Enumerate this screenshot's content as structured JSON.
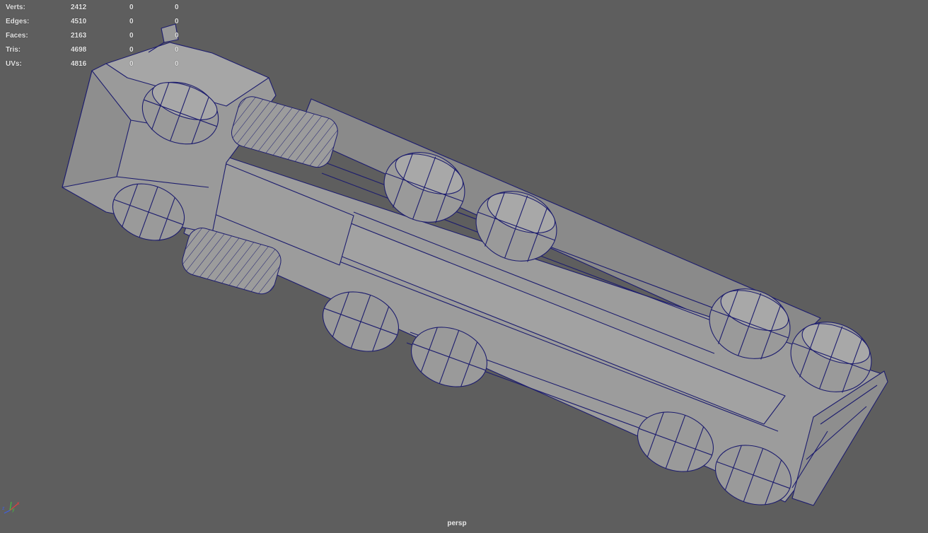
{
  "heads_up_display": {
    "rows": [
      {
        "label": "Verts:",
        "total": "2412",
        "selected": "0",
        "uv": "0"
      },
      {
        "label": "Edges:",
        "total": "4510",
        "selected": "0",
        "uv": "0"
      },
      {
        "label": "Faces:",
        "total": "2163",
        "selected": "0",
        "uv": "0"
      },
      {
        "label": "Tris:",
        "total": "4698",
        "selected": "0",
        "uv": "0"
      },
      {
        "label": "UVs:",
        "total": "4816",
        "selected": "0",
        "uv": "0"
      }
    ]
  },
  "viewport": {
    "camera_name": "persp",
    "background_color": "#5e5e5e",
    "wireframe_color": "#1d1d6e",
    "mesh_color": "#9a9a9a"
  },
  "axis_gizmo": {
    "x_label": "x",
    "y_label": "y",
    "z_label": "z",
    "x_color": "#e04040",
    "y_color": "#40c040",
    "z_color": "#4060e0"
  }
}
